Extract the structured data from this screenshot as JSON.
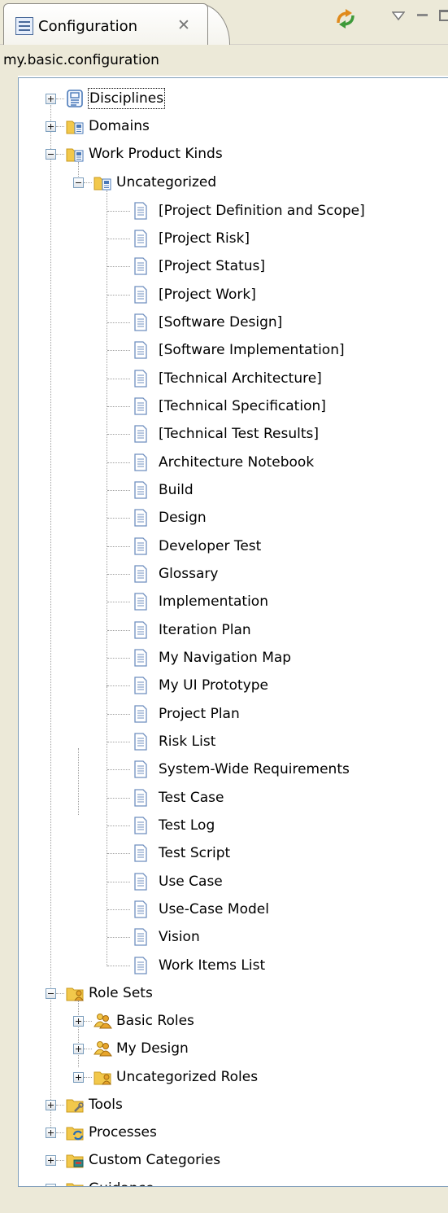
{
  "view": {
    "tab_title": "Configuration",
    "close_glyph": "✕",
    "icons": [
      "view-icon",
      "sync-icon",
      "view-menu-icon",
      "minimize-icon",
      "maximize-icon"
    ]
  },
  "configuration_name": "my.basic.configuration",
  "tree": {
    "disciplines": "Disciplines",
    "domains": "Domains",
    "work_product_kinds": "Work Product Kinds",
    "uncategorized": "Uncategorized",
    "work_products": [
      "[Project Definition and Scope]",
      "[Project Risk]",
      "[Project Status]",
      "[Project Work]",
      "[Software Design]",
      "[Software Implementation]",
      "[Technical Architecture]",
      "[Technical Specification]",
      "[Technical Test Results]",
      "Architecture Notebook",
      "Build",
      "Design",
      "Developer Test",
      "Glossary",
      "Implementation",
      "Iteration Plan",
      "My Navigation Map",
      "My UI Prototype",
      "Project Plan",
      "Risk List",
      "System-Wide Requirements",
      "Test Case",
      "Test Log",
      "Test Script",
      "Use Case",
      "Use-Case Model",
      "Vision",
      "Work Items List"
    ],
    "role_sets": "Role Sets",
    "basic_roles": "Basic Roles",
    "my_design": "My Design",
    "uncategorized_roles": "Uncategorized Roles",
    "tools": "Tools",
    "processes": "Processes",
    "custom_categories": "Custom Categories",
    "guidance": "Guidance"
  },
  "colors": {
    "folder": "#f2c84b",
    "folder_dark": "#c99a1e",
    "document": "#ffffff",
    "document_lines": "#6f8fbf",
    "tree_lines": "#a0a0a0",
    "chrome": "#ece9d8",
    "panel_border": "#7f9db9"
  }
}
